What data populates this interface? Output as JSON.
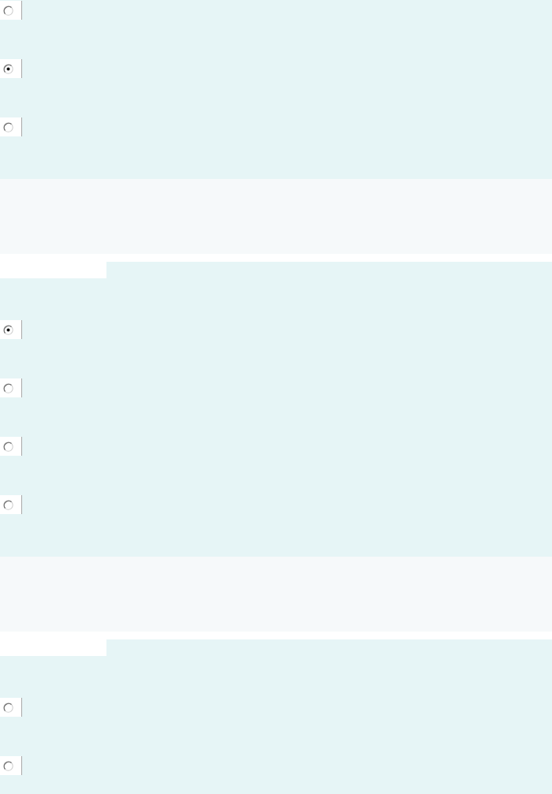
{
  "questions": [
    {
      "options": [
        {
          "selected": false
        },
        {
          "selected": true
        },
        {
          "selected": false
        }
      ]
    },
    {
      "options": [
        {
          "selected": true
        },
        {
          "selected": false
        },
        {
          "selected": false
        },
        {
          "selected": false
        }
      ]
    },
    {
      "options": [
        {
          "selected": false
        },
        {
          "selected": false
        }
      ]
    }
  ]
}
